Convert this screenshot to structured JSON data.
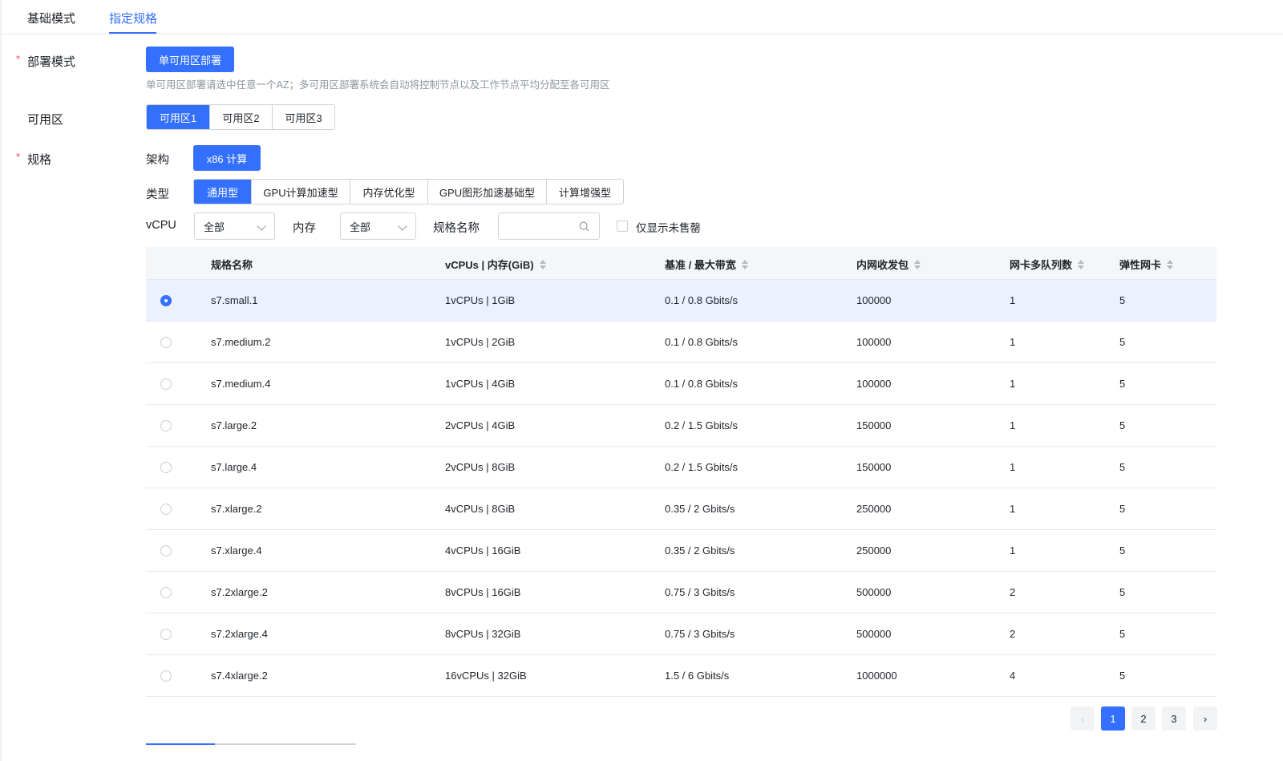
{
  "tabs": [
    {
      "label": "基础模式"
    },
    {
      "label": "指定规格"
    }
  ],
  "form": {
    "deploy": {
      "label": "部署模式",
      "required_mark": "*",
      "button": "单可用区部署",
      "hint": "单可用区部署请选中任意一个AZ；多可用区部署系统会自动将控制节点以及工作节点平均分配至各可用区"
    },
    "zone": {
      "label": "可用区",
      "options": [
        "可用区1",
        "可用区2",
        "可用区3"
      ],
      "selected": "可用区1"
    },
    "spec": {
      "label": "规格",
      "required_mark": "*",
      "arch_label": "架构",
      "arch_button": "x86 计算",
      "type_label": "类型",
      "types": [
        "通用型",
        "GPU计算加速型",
        "内存优化型",
        "GPU图形加速基础型",
        "计算增强型"
      ],
      "selected_type": "通用型",
      "vcpu_label": "vCPU",
      "vcpu_value": "全部",
      "mem_label": "内存",
      "mem_value": "全部",
      "name_label": "规格名称",
      "name_value": "",
      "unsold_label": "仅显示未售罄",
      "unsold_checked": false
    }
  },
  "table": {
    "headers": [
      "规格名称",
      "vCPUs | 内存(GiB)",
      "基准 / 最大带宽",
      "内网收发包",
      "网卡多队列数",
      "弹性网卡"
    ],
    "rows": [
      {
        "name": "s7.small.1",
        "cpu_mem": "1vCPUs | 1GiB",
        "bandwidth": "0.1 / 0.8 Gbits/s",
        "pps": "100000",
        "queues": "1",
        "eni": "5",
        "selected": true
      },
      {
        "name": "s7.medium.2",
        "cpu_mem": "1vCPUs | 2GiB",
        "bandwidth": "0.1 / 0.8 Gbits/s",
        "pps": "100000",
        "queues": "1",
        "eni": "5",
        "selected": false
      },
      {
        "name": "s7.medium.4",
        "cpu_mem": "1vCPUs | 4GiB",
        "bandwidth": "0.1 / 0.8 Gbits/s",
        "pps": "100000",
        "queues": "1",
        "eni": "5",
        "selected": false
      },
      {
        "name": "s7.large.2",
        "cpu_mem": "2vCPUs | 4GiB",
        "bandwidth": "0.2 / 1.5 Gbits/s",
        "pps": "150000",
        "queues": "1",
        "eni": "5",
        "selected": false
      },
      {
        "name": "s7.large.4",
        "cpu_mem": "2vCPUs | 8GiB",
        "bandwidth": "0.2 / 1.5 Gbits/s",
        "pps": "150000",
        "queues": "1",
        "eni": "5",
        "selected": false
      },
      {
        "name": "s7.xlarge.2",
        "cpu_mem": "4vCPUs | 8GiB",
        "bandwidth": "0.35 / 2 Gbits/s",
        "pps": "250000",
        "queues": "1",
        "eni": "5",
        "selected": false
      },
      {
        "name": "s7.xlarge.4",
        "cpu_mem": "4vCPUs | 16GiB",
        "bandwidth": "0.35 / 2 Gbits/s",
        "pps": "250000",
        "queues": "1",
        "eni": "5",
        "selected": false
      },
      {
        "name": "s7.2xlarge.2",
        "cpu_mem": "8vCPUs | 16GiB",
        "bandwidth": "0.75 / 3 Gbits/s",
        "pps": "500000",
        "queues": "2",
        "eni": "5",
        "selected": false
      },
      {
        "name": "s7.2xlarge.4",
        "cpu_mem": "8vCPUs | 32GiB",
        "bandwidth": "0.75 / 3 Gbits/s",
        "pps": "500000",
        "queues": "2",
        "eni": "5",
        "selected": false
      },
      {
        "name": "s7.4xlarge.2",
        "cpu_mem": "16vCPUs | 32GiB",
        "bandwidth": "1.5 / 6 Gbits/s",
        "pps": "1000000",
        "queues": "4",
        "eni": "5",
        "selected": false
      }
    ]
  },
  "pagination": {
    "prev": "‹",
    "pages": [
      "1",
      "2",
      "3"
    ],
    "current": "1",
    "next": "›"
  },
  "colors": {
    "accent": "#3370ff",
    "selected_row": "#ebf1fe",
    "required": "#f54a45"
  },
  "icons": [
    "search-icon",
    "chevron-down-icon",
    "sort-icon",
    "chevron-left-icon",
    "chevron-right-icon"
  ]
}
